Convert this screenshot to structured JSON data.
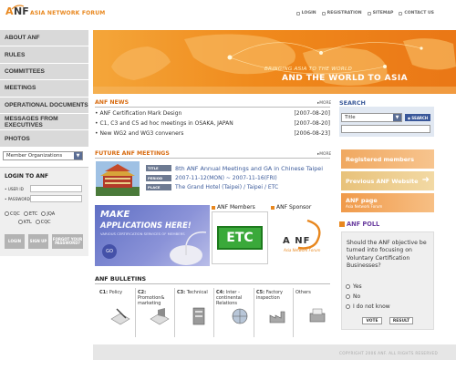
{
  "header": {
    "logo_letters": "A NF",
    "org_name": "ASIA NETWORK FORUM",
    "top_links": [
      "LOGIN",
      "REGISTRATION",
      "SITEMAP",
      "CONTACT US"
    ]
  },
  "nav": {
    "items": [
      "ABOUT ANF",
      "RULES",
      "COMMITTEES",
      "MEETINGS",
      "OPERATIONAL DOCUMENTS",
      "MESSAGES FROM EXECUTIVES",
      "PHOTOS"
    ],
    "member_select": "Member Organizations"
  },
  "login": {
    "title": "LOGIN TO ANF",
    "user_id_label": "• USER ID",
    "password_label": "• PASSWORD",
    "radios_row1": [
      "CQC",
      "ETC",
      "JQA"
    ],
    "radios_row2": [
      "KTL",
      "CQC"
    ],
    "login_btn": "LOGIN",
    "signup_btn": "SIGN UP",
    "forgot_btn": "FORGOT YOUR PASSWORD?"
  },
  "banner": {
    "line1": "BRINGING ASIA TO THE WORLD",
    "line2": "AND THE WORLD TO ASIA"
  },
  "news": {
    "title": "ANF NEWS",
    "more": "▸MORE",
    "items": [
      {
        "text": "• ANF Certification Mark Design",
        "date": "[2007-08-20]"
      },
      {
        "text": "• C1, C3 and C5 ad hoc meetings in OSAKA, JAPAN",
        "date": "[2007-08-20]"
      },
      {
        "text": "• New WG2 and WG3 conveners",
        "date": "[2006-08-23]"
      }
    ]
  },
  "meetings": {
    "title": "FUTURE ANF MEETINGS",
    "more": "▸MORE",
    "labels": [
      "TITLE",
      "PERIOD",
      "PLACE"
    ],
    "title_value": "8th ANF Annual Meetings and GA in Chinese Taipei",
    "period_value": "2007-11-12(MON) ~ 2007-11-16(FRI)",
    "place_value": "The Grand Hotel (Taipei) / Taipei / ETC"
  },
  "promo": {
    "make_app_line1": "MAKE",
    "make_app_line2": "APPLICATIONS HERE!",
    "make_app_sub": "VARIOUS CERTIFICATION SERVICES OF MEMBERS",
    "go": "GO",
    "members_title": "ANF Members",
    "members_logo": "ETC",
    "sponsor_title": "ANF Sponsor",
    "sponsor_logo": "A NF",
    "sponsor_sub": "Asia Network Forum"
  },
  "bulletins": {
    "title": "ANF BULLETINS",
    "categories": [
      {
        "code": "C1:",
        "name": "Policy"
      },
      {
        "code": "C2:",
        "name": "Promotion& marketing"
      },
      {
        "code": "C3:",
        "name": "Technical"
      },
      {
        "code": "C4:",
        "name": "Inter - continental Relations"
      },
      {
        "code": "C5:",
        "name": "Factory inspection"
      },
      {
        "code": "",
        "name": "Others"
      }
    ]
  },
  "search": {
    "title": "SEARCH",
    "select_value": "Title",
    "button": "SEARCH"
  },
  "quick_links": {
    "registered": "Registered members",
    "previous": "Previous ANF Website",
    "anf_page": "ANF page",
    "anf_page_sub": "Asia Network Forum"
  },
  "poll": {
    "title": "ANF POLL",
    "question": "Should the ANF objective be turned into focusing on Voluntary Certification Businesses?",
    "options": [
      "Yes",
      "No",
      "I do not know"
    ],
    "vote_btn": "VOTE",
    "result_btn": "RESULT"
  },
  "footer": {
    "copyright": "COPYRIGHT 2006 ANF. ALL RIGHTS RESERVED"
  },
  "colors": {
    "accent_orange": "#e8871e",
    "nav_gray": "#d9d9d9",
    "label_slate": "#6d7a92",
    "link_blue": "#3b5a9a",
    "poll_purple": "#6b3fa0"
  }
}
